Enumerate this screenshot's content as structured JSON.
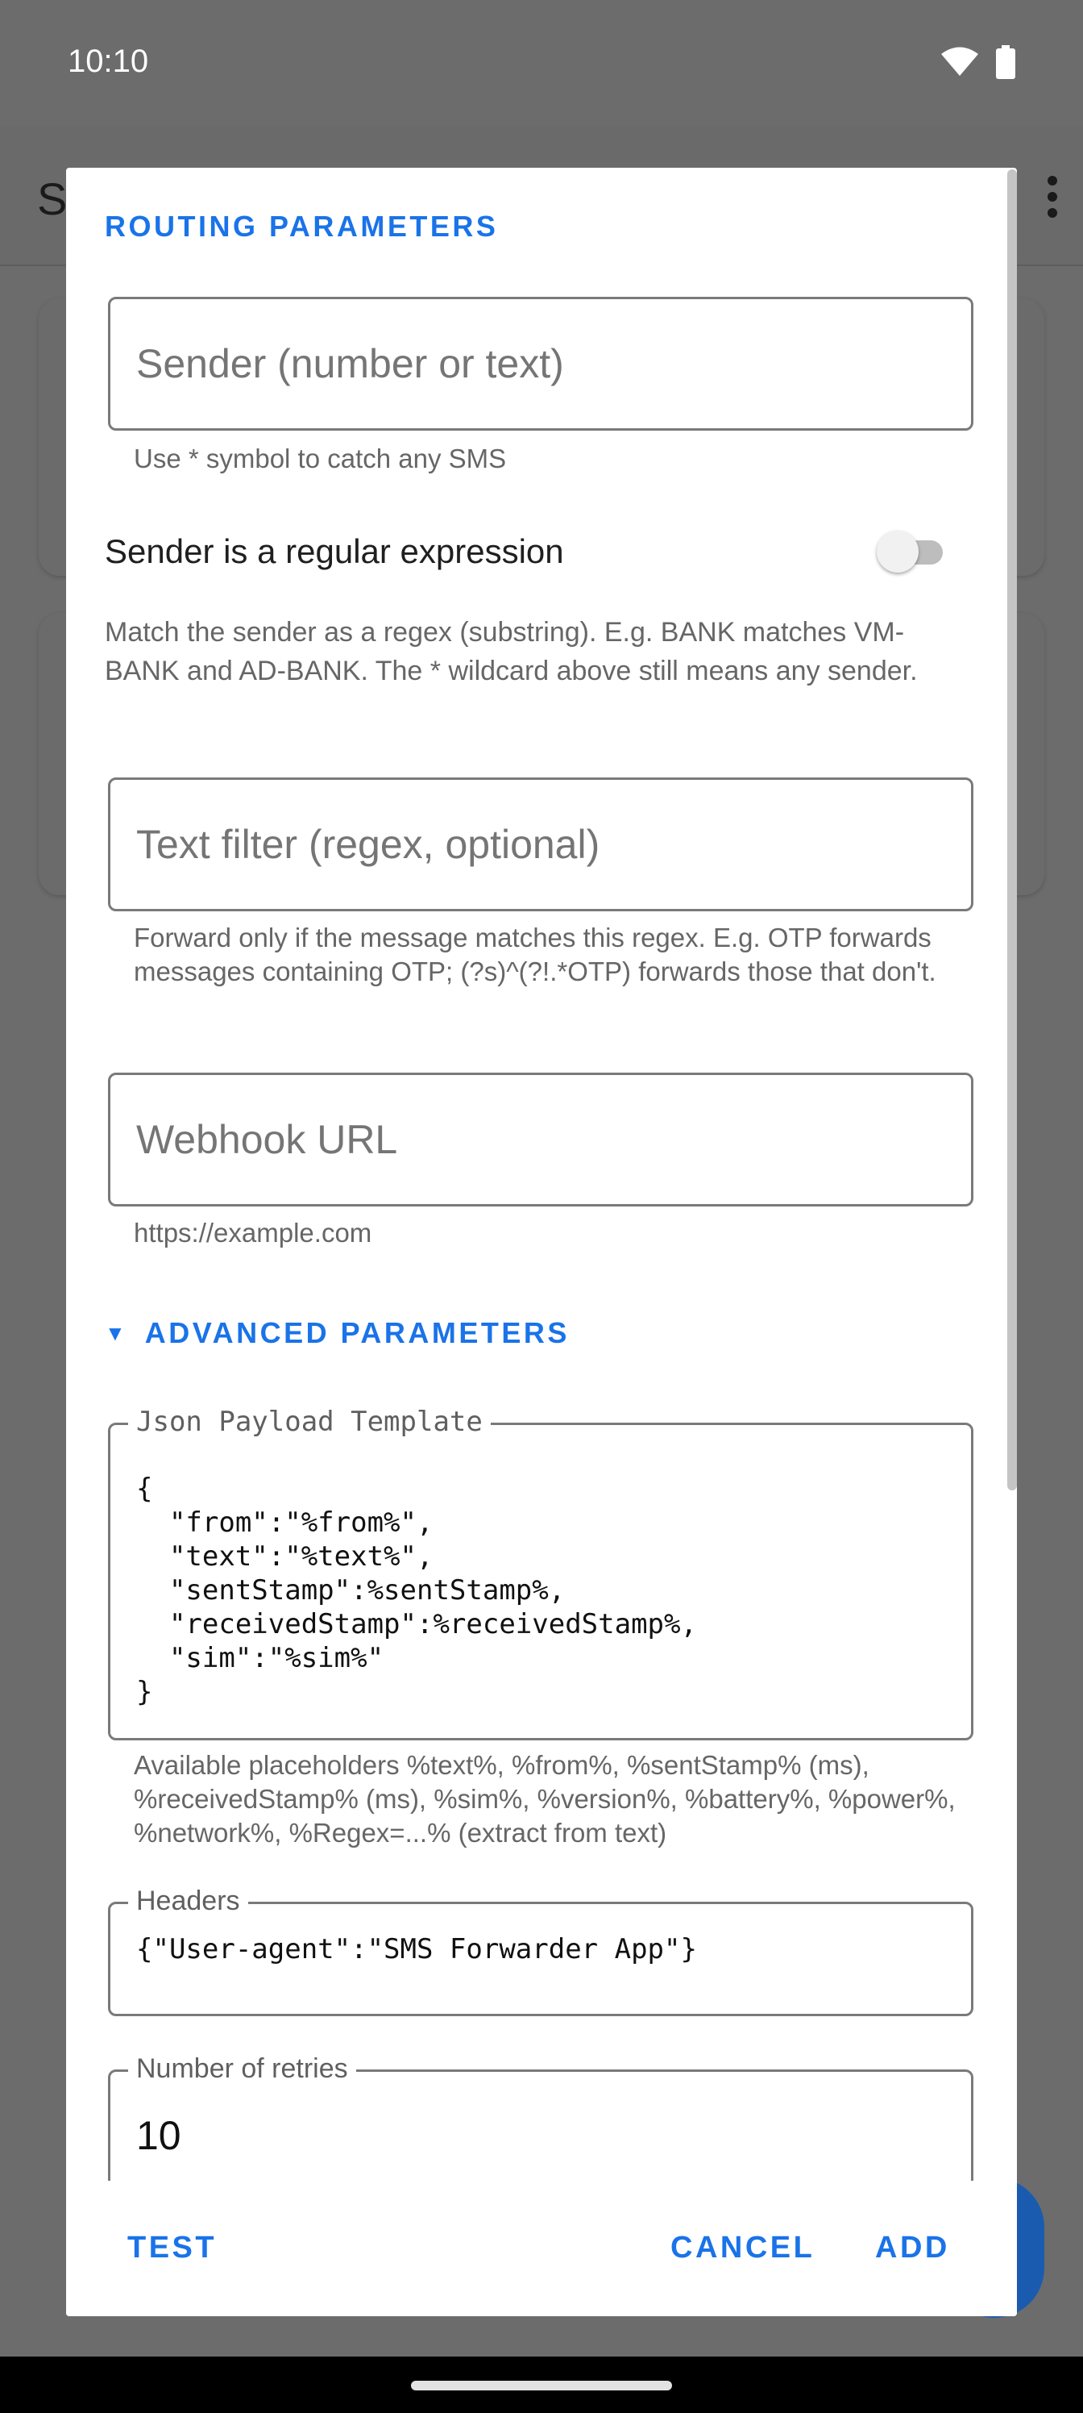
{
  "status_bar": {
    "time": "10:10",
    "icons": [
      "wifi-icon",
      "battery-icon"
    ]
  },
  "background_app": {
    "title_partial": "S",
    "menu_icon": "more-vert-icon"
  },
  "dialog": {
    "section_title": "ROUTING PARAMETERS",
    "sender": {
      "placeholder": "Sender (number or text)",
      "helper": "Use * symbol to catch any SMS"
    },
    "regex_toggle": {
      "label": "Sender is a regular expression",
      "enabled": false,
      "description": "Match the sender as a regex (substring). E.g. BANK matches VM-BANK and AD-BANK. The * wildcard above still means any sender."
    },
    "text_filter": {
      "placeholder": "Text filter (regex, optional)",
      "helper": "Forward only if the message matches this regex. E.g. OTP forwards messages containing OTP; (?s)^(?!.*OTP) forwards those that don't."
    },
    "webhook": {
      "placeholder": "Webhook URL",
      "helper": "https://example.com"
    },
    "advanced": {
      "arrow_icon": "triangle-down-icon",
      "label": "ADVANCED PARAMETERS",
      "json_template": {
        "label": "Json Payload Template",
        "value": "{\n  \"from\":\"%from%\",\n  \"text\":\"%text%\",\n  \"sentStamp\":%sentStamp%,\n  \"receivedStamp\":%receivedStamp%,\n  \"sim\":\"%sim%\"\n}",
        "helper": "Available placeholders %text%, %from%, %sentStamp% (ms), %receivedStamp% (ms), %sim%, %version%, %battery%, %power%, %network%, %Regex=...% (extract from text)"
      },
      "headers": {
        "label": "Headers",
        "value": "{\"User-agent\":\"SMS Forwarder App\"}"
      },
      "retries": {
        "label": "Number of retries",
        "value": "10"
      }
    },
    "actions": {
      "test": "TEST",
      "cancel": "CANCEL",
      "add": "ADD"
    }
  },
  "colors": {
    "accent": "#1a73e8",
    "scrim": "#6c6c6c",
    "outline": "#7a7a7a"
  }
}
